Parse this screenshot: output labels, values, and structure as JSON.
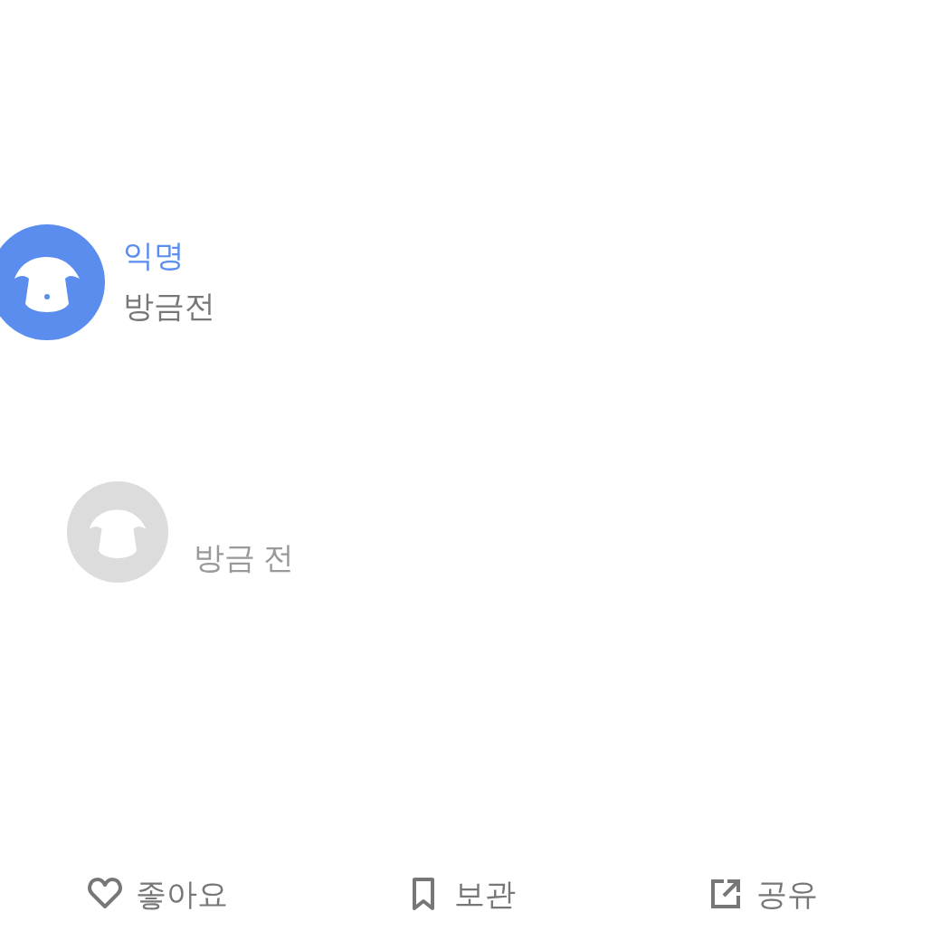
{
  "post": {
    "author": "익명",
    "time": "방금전"
  },
  "comment": {
    "time": "방금 전"
  },
  "actions": [
    {
      "kind": "like",
      "label": "좋아요"
    },
    {
      "kind": "bookmark",
      "label": "보관"
    },
    {
      "kind": "share",
      "label": "공유"
    }
  ]
}
